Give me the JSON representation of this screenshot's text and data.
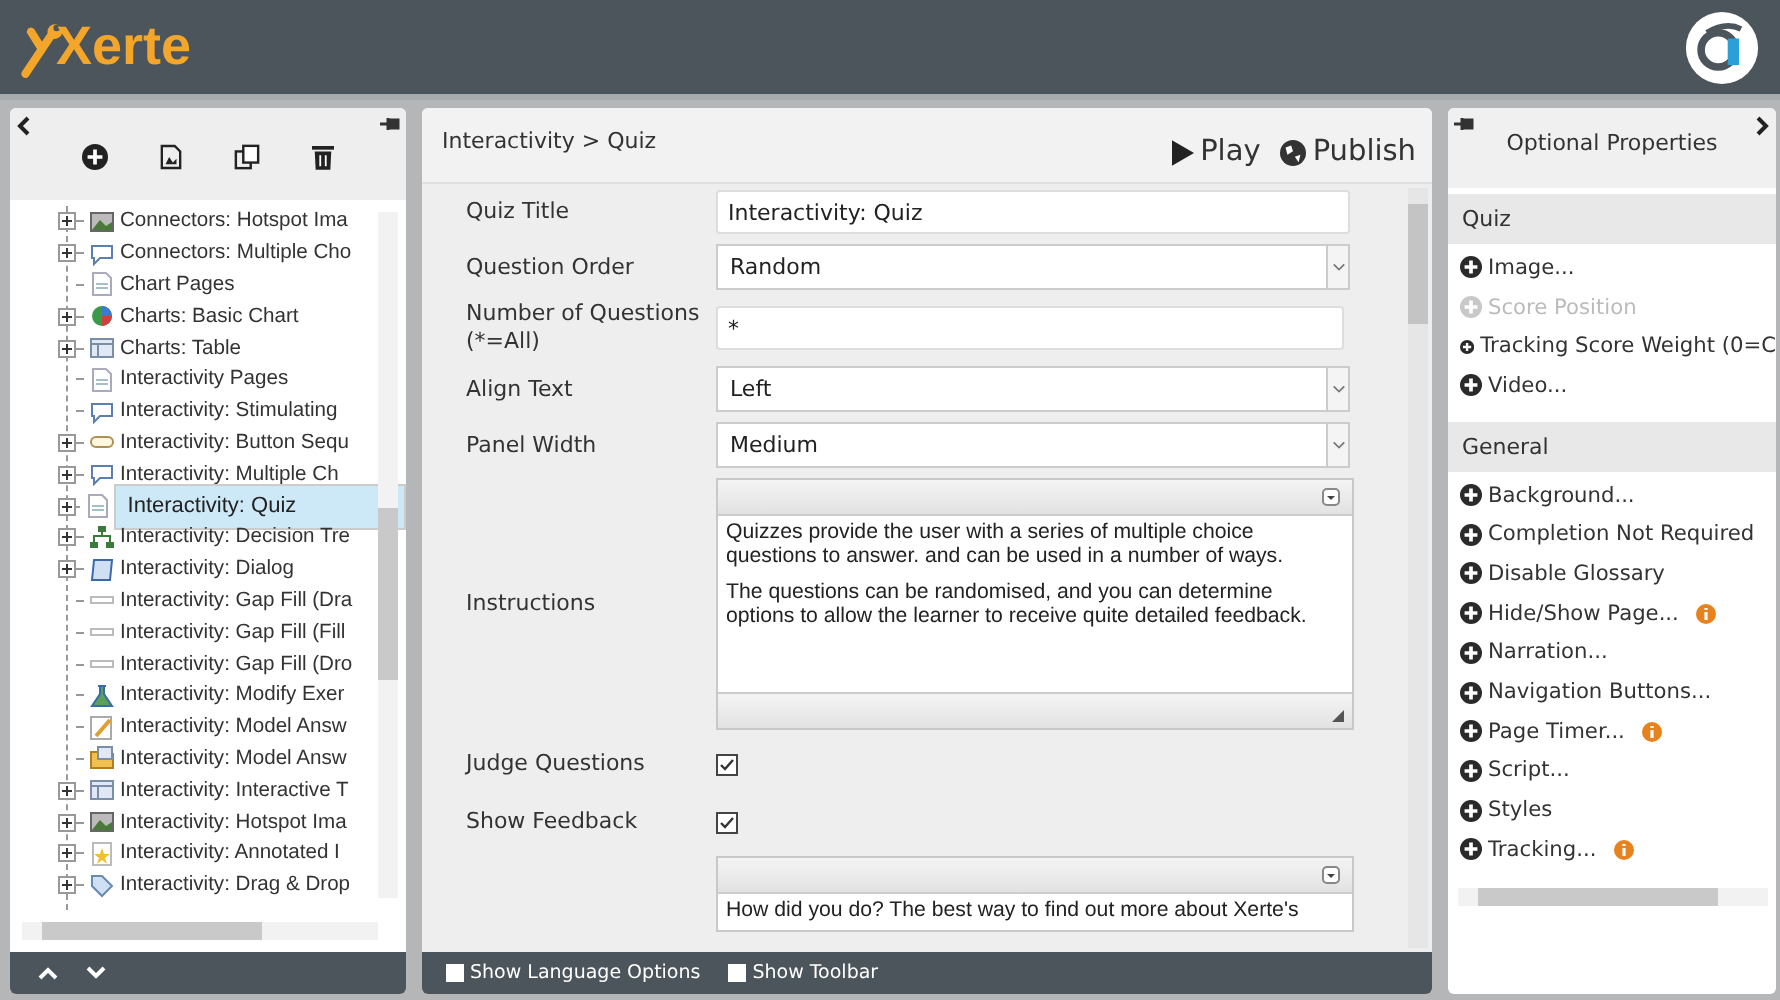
{
  "header": {
    "logo": "Xerte"
  },
  "tree": [
    {
      "label": "Connectors: Hotspot Ima",
      "expandable": true,
      "selected": false,
      "kind": "picture"
    },
    {
      "label": "Connectors: Multiple Cho",
      "expandable": true,
      "selected": false,
      "kind": "speech"
    },
    {
      "label": "Chart Pages",
      "expandable": false,
      "selected": false,
      "kind": "page"
    },
    {
      "label": "Charts: Basic Chart",
      "expandable": true,
      "selected": false,
      "kind": "pie"
    },
    {
      "label": "Charts: Table",
      "expandable": true,
      "selected": false,
      "kind": "table"
    },
    {
      "label": "Interactivity Pages",
      "expandable": false,
      "selected": false,
      "kind": "page"
    },
    {
      "label": "Interactivity: Stimulating",
      "expandable": false,
      "selected": false,
      "kind": "speech"
    },
    {
      "label": "Interactivity: Button Sequ",
      "expandable": true,
      "selected": false,
      "kind": "button"
    },
    {
      "label": "Interactivity: Multiple Ch",
      "expandable": true,
      "selected": false,
      "kind": "speech"
    },
    {
      "label": "Interactivity: Quiz",
      "expandable": true,
      "selected": true,
      "kind": "page"
    },
    {
      "label": "Interactivity: Decision Tre",
      "expandable": true,
      "selected": false,
      "kind": "tree"
    },
    {
      "label": "Interactivity: Dialog",
      "expandable": true,
      "selected": false,
      "kind": "dialog"
    },
    {
      "label": "Interactivity: Gap Fill (Dra",
      "expandable": false,
      "selected": false,
      "kind": "bar"
    },
    {
      "label": "Interactivity: Gap Fill (Fill",
      "expandable": false,
      "selected": false,
      "kind": "bar"
    },
    {
      "label": "Interactivity: Gap Fill (Dro",
      "expandable": false,
      "selected": false,
      "kind": "bar"
    },
    {
      "label": "Interactivity: Modify Exer",
      "expandable": false,
      "selected": false,
      "kind": "flask"
    },
    {
      "label": "Interactivity: Model Answ",
      "expandable": false,
      "selected": false,
      "kind": "pencil"
    },
    {
      "label": "Interactivity: Model Answ",
      "expandable": false,
      "selected": false,
      "kind": "folder"
    },
    {
      "label": "Interactivity: Interactive T",
      "expandable": true,
      "selected": false,
      "kind": "table"
    },
    {
      "label": "Interactivity: Hotspot Ima",
      "expandable": true,
      "selected": false,
      "kind": "picture"
    },
    {
      "label": "Interactivity: Annotated I",
      "expandable": true,
      "selected": false,
      "kind": "star"
    },
    {
      "label": "Interactivity: Drag & Drop",
      "expandable": true,
      "selected": false,
      "kind": "tag"
    }
  ],
  "editor": {
    "breadcrumb": "Interactivity > Quiz",
    "play": "Play",
    "publish": "Publish",
    "fields": [
      {
        "kind": "text",
        "label": "Quiz Title",
        "value": "Interactivity: Quiz"
      },
      {
        "kind": "select",
        "label": "Question Order",
        "value": "Random"
      },
      {
        "kind": "text",
        "label": "Number of Questions (*=All)",
        "value": "*"
      },
      {
        "kind": "select",
        "label": "Align Text",
        "value": "Left"
      },
      {
        "kind": "select",
        "label": "Panel Width",
        "value": "Medium"
      },
      {
        "kind": "richtext",
        "label": "Instructions",
        "paragraphs": [
          "Quizzes provide the user with a series of multiple choice questions to answer. and can be used in a number of ways.",
          "The questions can be randomised, and you can determine options to allow the learner to receive quite detailed feedback."
        ]
      },
      {
        "kind": "checkbox",
        "label": "Judge Questions",
        "checked": true
      },
      {
        "kind": "checkbox",
        "label": "Show Feedback",
        "checked": true
      },
      {
        "kind": "richtext_cut",
        "paragraphs": [
          "How did you do? The best way to find out more about Xerte's"
        ]
      }
    ],
    "options": [
      {
        "label": "Show Language Options",
        "checked": false
      },
      {
        "label": "Show Toolbar",
        "checked": false
      }
    ]
  },
  "properties": {
    "title": "Optional Properties",
    "sections": [
      {
        "heading": "Quiz",
        "items": [
          {
            "label": "Image...",
            "disabled": false,
            "info": false
          },
          {
            "label": "Score Position",
            "disabled": true,
            "info": false
          },
          {
            "label": "Tracking Score Weight (0=C",
            "disabled": false,
            "info": false
          },
          {
            "label": "Video...",
            "disabled": false,
            "info": false
          }
        ]
      },
      {
        "heading": "General",
        "items": [
          {
            "label": "Background...",
            "disabled": false,
            "info": false
          },
          {
            "label": "Completion Not Required",
            "disabled": false,
            "info": false
          },
          {
            "label": "Disable Glossary",
            "disabled": false,
            "info": false
          },
          {
            "label": "Hide/Show Page...",
            "disabled": false,
            "info": true
          },
          {
            "label": "Narration...",
            "disabled": false,
            "info": false
          },
          {
            "label": "Navigation Buttons...",
            "disabled": false,
            "info": false
          },
          {
            "label": "Page Timer...",
            "disabled": false,
            "info": true
          },
          {
            "label": "Script...",
            "disabled": false,
            "info": false
          },
          {
            "label": "Styles",
            "disabled": false,
            "info": false
          },
          {
            "label": "Tracking...",
            "disabled": false,
            "info": true
          }
        ]
      }
    ]
  }
}
